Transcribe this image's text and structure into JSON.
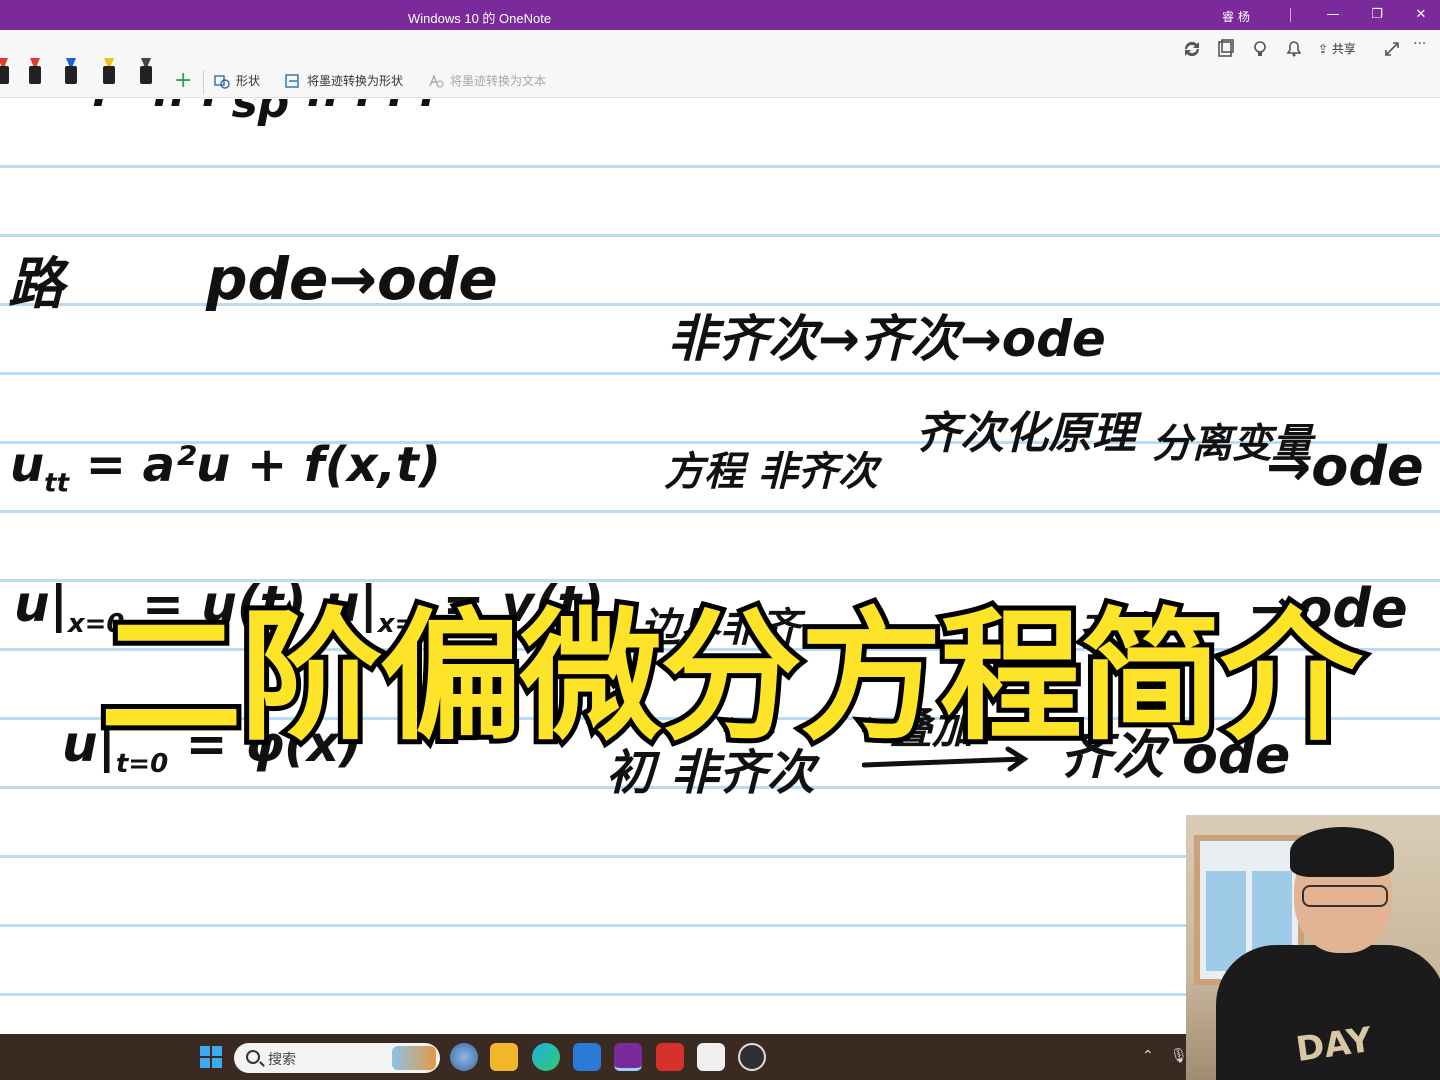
{
  "window": {
    "title": "Windows 10 的 OneNote",
    "user": "睿 杨",
    "controls": {
      "minimize": "—",
      "maximize": "❐",
      "close": "✕"
    }
  },
  "toolbar": {
    "top_icons": [
      "sync-icon",
      "pages-icon",
      "lightbulb-icon",
      "bell-icon",
      "share-icon",
      "expand-icon",
      "more-icon"
    ],
    "share_label": "共享",
    "more_label": "···",
    "shape_label": "形状",
    "ink_to_shape_label": "将墨迹转换为形状",
    "ink_to_text_label": "将墨迹转换为文本",
    "pen_colors": [
      "#e03c28",
      "#1d5fd6",
      "#f2c21b",
      "#222222"
    ],
    "add_pen": "+"
  },
  "canvas": {
    "ink": {
      "top_fragment": "· ' ·· · sp ·· · · ·",
      "lu": "路",
      "pde_ode": "pde→ode",
      "nonhom_hom": "非齐次→齐次→ode",
      "utt": "u",
      "utt_sub": "tt",
      "utt_rest": "= a²u   + f(x,t)",
      "equation_nonhom": "方程 非齐次",
      "hom_principle": "齐次化原理",
      "sep_var": "分离变量",
      "arrow_ode_1": "→ode",
      "bc_left": "u|",
      "bc_left_sub": "x=0",
      "bc_left_rest": "= u(t)   u|",
      "bc_right_sub": "x=l",
      "bc_right_rest": "= v(t)",
      "boundary_nonhom": "边界非齐",
      "hom_next": "齐次",
      "arrow_ode_2": "→ode",
      "ic": "u|",
      "ic_sub": "t=0",
      "ic_rest": "= φ(x)",
      "initial_nonhom": "初 非齐次",
      "superpose": "叠加",
      "hom_ode": "齐次 ode"
    },
    "banner": "二阶偏微分方程简介"
  },
  "taskbar": {
    "search_placeholder": "搜索",
    "apps": [
      "start-icon",
      "widgets-icon",
      "file-explorer-icon",
      "edge-icon",
      "mail-icon",
      "onenote-icon",
      "wps-icon",
      "pinwheel-icon",
      "obs-icon"
    ],
    "tray": [
      "chevron-up-icon",
      "microphone-icon"
    ]
  },
  "webcam": {
    "shirt_print": "DAY"
  },
  "colors": {
    "titlebar": "#7a2a9b",
    "banner_fill": "#fde428",
    "ruled_line": "#b9dcf4"
  }
}
